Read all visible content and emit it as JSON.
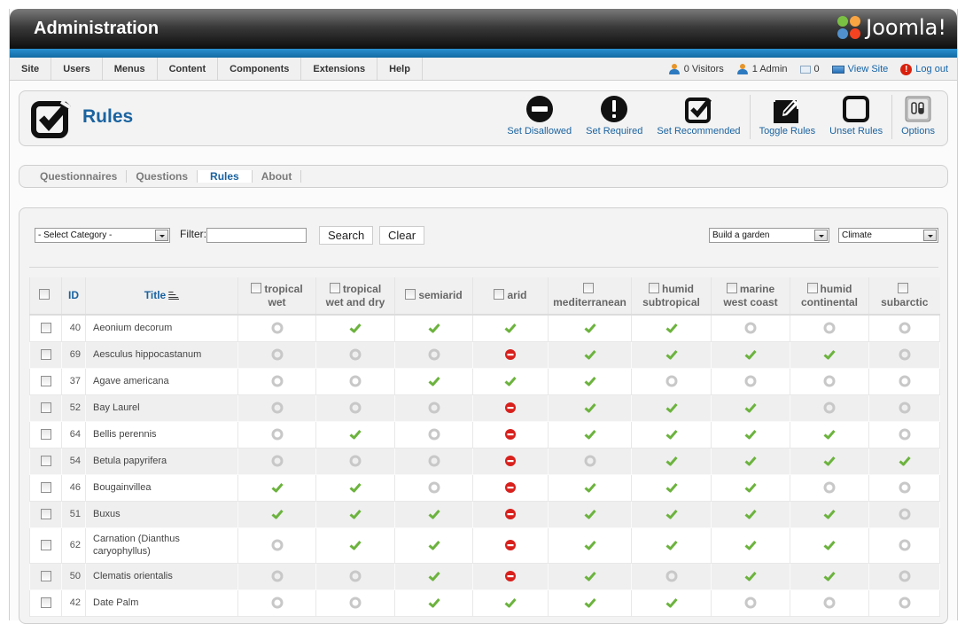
{
  "header": {
    "title": "Administration",
    "logo_text": "Joomla!"
  },
  "menubar": {
    "items": [
      "Site",
      "Users",
      "Menus",
      "Content",
      "Components",
      "Extensions",
      "Help"
    ]
  },
  "status": {
    "visitors": "0 Visitors",
    "admins": "1 Admin",
    "messages": "0",
    "view_site": "View Site",
    "logout": "Log out"
  },
  "toolbar": {
    "page_title": "Rules",
    "buttons": [
      {
        "label": "Set Disallowed",
        "icon": "minus-circle-icon"
      },
      {
        "label": "Set Required",
        "icon": "exclamation-circle-icon"
      },
      {
        "label": "Set Recommended",
        "icon": "checkbox-check-icon"
      },
      {
        "label": "Toggle Rules",
        "icon": "pencil-edit-icon"
      },
      {
        "label": "Unset Rules",
        "icon": "empty-square-icon"
      },
      {
        "label": "Options",
        "icon": "options-icon"
      }
    ]
  },
  "submenu": {
    "items": [
      "Questionnaires",
      "Questions",
      "Rules",
      "About"
    ],
    "active": "Rules"
  },
  "filters": {
    "category_select": "- Select Category -",
    "filter_label": "Filter:",
    "filter_value": "",
    "search_label": "Search",
    "clear_label": "Clear",
    "questionnaire_select": "Build a garden",
    "question_select": "Climate"
  },
  "table": {
    "headers": {
      "id": "ID",
      "title": "Title",
      "columns": [
        [
          "tropical",
          "wet"
        ],
        [
          "tropical",
          "wet and dry"
        ],
        [
          "semiarid"
        ],
        [
          "arid"
        ],
        [
          "",
          "mediterranean"
        ],
        [
          "humid",
          "subtropical"
        ],
        [
          "marine",
          "west coast"
        ],
        [
          "humid",
          "continental"
        ],
        [
          "",
          "subarctic"
        ]
      ]
    },
    "rows": [
      {
        "id": "40",
        "title": "Aeonium decorum",
        "rules": [
          "none",
          "recommended",
          "recommended",
          "recommended",
          "recommended",
          "recommended",
          "none",
          "none",
          "none"
        ]
      },
      {
        "id": "69",
        "title": "Aesculus hippocastanum",
        "rules": [
          "none",
          "none",
          "none",
          "disallowed",
          "recommended",
          "recommended",
          "recommended",
          "recommended",
          "none"
        ]
      },
      {
        "id": "37",
        "title": "Agave americana",
        "rules": [
          "none",
          "none",
          "recommended",
          "recommended",
          "recommended",
          "none",
          "none",
          "none",
          "none"
        ]
      },
      {
        "id": "52",
        "title": "Bay Laurel",
        "rules": [
          "none",
          "none",
          "none",
          "disallowed",
          "recommended",
          "recommended",
          "recommended",
          "none",
          "none"
        ]
      },
      {
        "id": "64",
        "title": "Bellis perennis",
        "rules": [
          "none",
          "recommended",
          "none",
          "disallowed",
          "recommended",
          "recommended",
          "recommended",
          "recommended",
          "none"
        ]
      },
      {
        "id": "54",
        "title": "Betula papyrifera",
        "rules": [
          "none",
          "none",
          "none",
          "disallowed",
          "none",
          "recommended",
          "recommended",
          "recommended",
          "recommended"
        ]
      },
      {
        "id": "46",
        "title": "Bougainvillea",
        "rules": [
          "recommended",
          "recommended",
          "none",
          "disallowed",
          "recommended",
          "recommended",
          "recommended",
          "none",
          "none"
        ]
      },
      {
        "id": "51",
        "title": "Buxus",
        "rules": [
          "recommended",
          "recommended",
          "recommended",
          "disallowed",
          "recommended",
          "recommended",
          "recommended",
          "recommended",
          "none"
        ]
      },
      {
        "id": "62",
        "title": "Carnation (Dianthus caryophyllus)",
        "rules": [
          "none",
          "recommended",
          "recommended",
          "disallowed",
          "recommended",
          "recommended",
          "recommended",
          "recommended",
          "none"
        ]
      },
      {
        "id": "50",
        "title": "Clematis orientalis",
        "rules": [
          "none",
          "none",
          "recommended",
          "disallowed",
          "recommended",
          "none",
          "recommended",
          "recommended",
          "none"
        ]
      },
      {
        "id": "42",
        "title": "Date Palm",
        "rules": [
          "none",
          "none",
          "recommended",
          "recommended",
          "recommended",
          "recommended",
          "none",
          "none",
          "none"
        ]
      }
    ]
  },
  "colors": {
    "header_blue": "#1a63a0",
    "recommended": "#6cb33e",
    "disallowed": "#d8201c",
    "none": "#c8c8c8"
  }
}
